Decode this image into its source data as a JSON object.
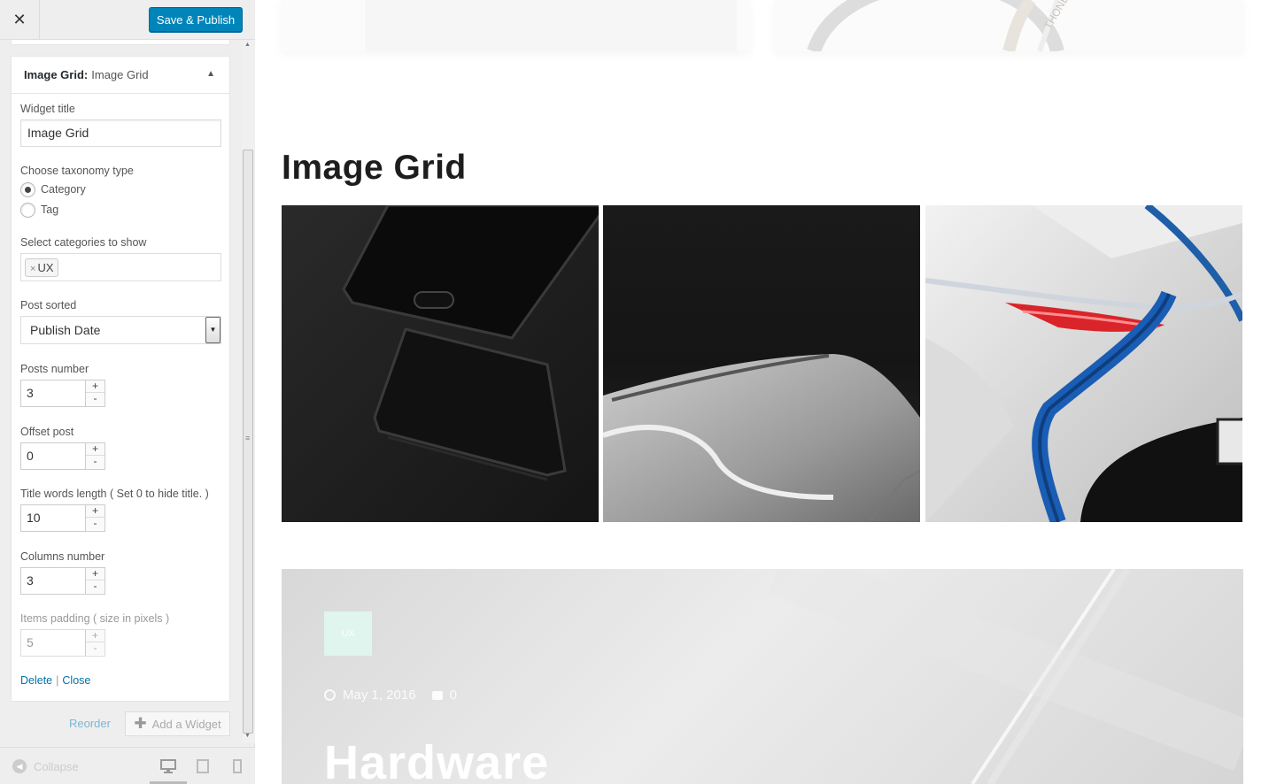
{
  "header": {
    "publish_label": "Save & Publish"
  },
  "widget": {
    "type_label": "Image Grid:",
    "name": "Image Grid",
    "fields": {
      "title_label": "Widget title",
      "title_value": "Image Grid",
      "taxonomy_label": "Choose taxonomy type",
      "taxonomy_options": [
        "Category",
        "Tag"
      ],
      "taxonomy_selected": "Category",
      "categories_label": "Select categories to show",
      "categories_selected": [
        "UX"
      ],
      "sorted_label": "Post sorted",
      "sorted_value": "Publish Date",
      "posts_number_label": "Posts number",
      "posts_number": "3",
      "offset_label": "Offset post",
      "offset": "0",
      "title_words_label": "Title words length ( Set 0 to hide title. )",
      "title_words": "10",
      "columns_label": "Columns number",
      "columns": "3",
      "padding_label": "Items padding ( size in pixels )",
      "padding": "5"
    },
    "delete_label": "Delete",
    "close_label": "Close"
  },
  "actions": {
    "reorder_label": "Reorder",
    "add_widget_label": "Add a Widget"
  },
  "footer": {
    "collapse_label": "Collapse"
  },
  "preview": {
    "section_title": "Image Grid",
    "post": {
      "category": "UX",
      "date": "May 1, 2016",
      "comments": "0",
      "title": "Hardware"
    }
  },
  "icons": {
    "close": "close-icon",
    "collapse_arrow": "triangle-up-icon",
    "tag_remove": "x-icon",
    "select_dropdown": "chevron-down-icon",
    "spinner_up": "plus-icon",
    "spinner_down": "minus-icon",
    "add": "plus-icon",
    "collapse": "arrow-left-circle-icon",
    "desktop": "desktop-icon",
    "tablet": "tablet-icon",
    "mobile": "mobile-icon",
    "clock": "clock-icon",
    "comment": "comment-icon"
  },
  "colors": {
    "primary": "#0085ba",
    "link": "#0073aa",
    "badge": "#dff5ee"
  }
}
